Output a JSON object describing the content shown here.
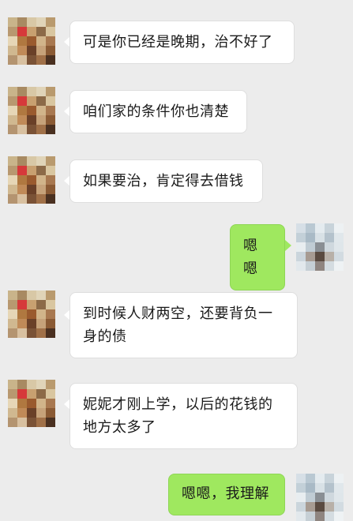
{
  "colors": {
    "background": "#ececec",
    "incoming_bubble": "#ffffff",
    "outgoing_bubble": "#9fe85f"
  },
  "messages": [
    {
      "sender": "contact",
      "text": "可是你已经是晚期，治不好了"
    },
    {
      "sender": "contact",
      "text": "咱们家的条件你也清楚"
    },
    {
      "sender": "contact",
      "text": "如果要治，肯定得去借钱"
    },
    {
      "sender": "self",
      "text": "嗯嗯"
    },
    {
      "sender": "contact",
      "text": "到时候人财两空，还要背负一身的债"
    },
    {
      "sender": "contact",
      "text": "妮妮才刚上学，以后的花钱的地方太多了"
    },
    {
      "sender": "self",
      "text": "嗯嗯，我理解"
    }
  ]
}
